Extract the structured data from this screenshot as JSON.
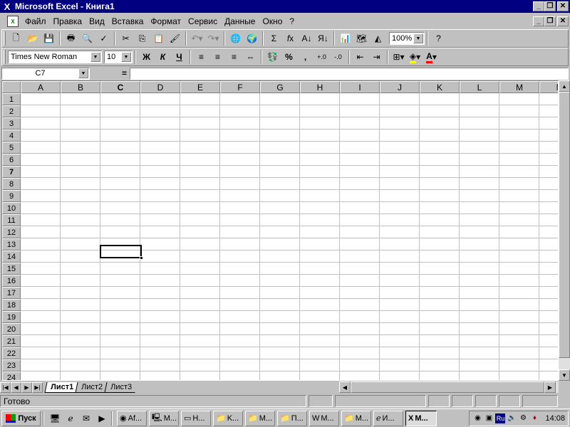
{
  "window": {
    "title": "Microsoft Excel - Книга1",
    "app_icon": "excel-x-icon"
  },
  "menubar": {
    "items": [
      "Файл",
      "Правка",
      "Вид",
      "Вставка",
      "Формат",
      "Сервис",
      "Данные",
      "Окно",
      "?"
    ]
  },
  "toolbar_standard": {
    "zoom": "100%"
  },
  "toolbar_formatting": {
    "font_name": "Times New Roman",
    "font_size": "10",
    "bold": "Ж",
    "italic": "К",
    "underline": "Ч",
    "percent": "%",
    "comma": ","
  },
  "formula_bar": {
    "name_box": "C7",
    "equals": "=",
    "value": ""
  },
  "grid": {
    "columns": [
      "A",
      "B",
      "C",
      "D",
      "E",
      "F",
      "G",
      "H",
      "I",
      "J",
      "K",
      "L",
      "M",
      "N"
    ],
    "rows": [
      "1",
      "2",
      "3",
      "4",
      "5",
      "6",
      "7",
      "8",
      "9",
      "10",
      "11",
      "12",
      "13",
      "14",
      "15",
      "16",
      "17",
      "18",
      "19",
      "20",
      "21",
      "22",
      "23",
      "24"
    ],
    "active_column": "C",
    "active_row": "7"
  },
  "sheet_tabs": [
    "Лист1",
    "Лист2",
    "Лист3"
  ],
  "active_sheet": "Лист1",
  "status": {
    "text": "Готово"
  },
  "taskbar": {
    "start_label": "Пуск",
    "tasks": [
      {
        "label": "Af...",
        "icon": "app-icon"
      },
      {
        "label": "M...",
        "icon": "computer-icon"
      },
      {
        "label": "H...",
        "icon": "drive-icon"
      },
      {
        "label": "K...",
        "icon": "folder-icon"
      },
      {
        "label": "M...",
        "icon": "folder-icon"
      },
      {
        "label": "П...",
        "icon": "folder-icon"
      },
      {
        "label": "M...",
        "icon": "word-icon"
      },
      {
        "label": "M...",
        "icon": "folder-icon"
      },
      {
        "label": "И...",
        "icon": "explorer-icon"
      },
      {
        "label": "M...",
        "icon": "excel-icon"
      }
    ],
    "active_task_index": 9,
    "tray_lang": "Ru",
    "clock": "14:08"
  }
}
